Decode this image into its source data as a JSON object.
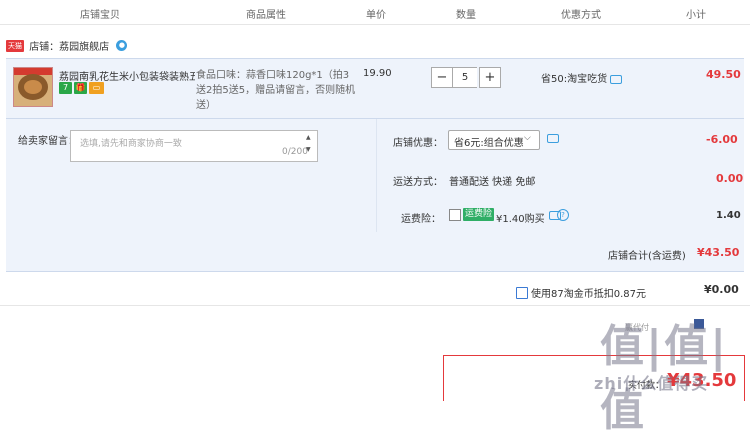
{
  "header": {
    "col_item": "店铺宝贝",
    "col_props": "商品属性",
    "col_price": "单价",
    "col_qty": "数量",
    "col_promo": "优惠方式",
    "col_subtotal": "小计"
  },
  "store": {
    "tag": "天猫",
    "name": "店铺：荔园旗舰店",
    "chat_icon": "chat-icon"
  },
  "item": {
    "title": "荔园南乳花生米小包装袋装熟五...",
    "badges": [
      {
        "text": "7",
        "color": "#2aa748"
      },
      {
        "text": "🎁",
        "color": "#2aa748"
      },
      {
        "text": "▭",
        "color": "#f0a020"
      }
    ],
    "props": "食品口味：蒜香口味120g*1（拍3送2拍5送5，赠品请留言，否则随机送）",
    "price": "19.90",
    "qty": "5",
    "promo": "省50:淘宝吃货",
    "subtotal": "49.50"
  },
  "message": {
    "label": "给卖家留言：",
    "placeholder": "选填,请先和商家协商一致",
    "counter": "0/200"
  },
  "store_discount": {
    "label": "店铺优惠：",
    "selected": "省6元:组合优惠",
    "amount": "-6.00"
  },
  "shipping": {
    "label": "运送方式：",
    "value": "普通配送 快递 免邮",
    "amount": "0.00"
  },
  "insurance": {
    "label": "运费险：",
    "tag": "运费险",
    "text": "¥1.40购买",
    "amount": "1.40"
  },
  "store_total": {
    "label": "店铺合计(含运费)",
    "amount": "¥43.50"
  },
  "coins": {
    "text": "使用87淘金币抵扣0.87元",
    "amount": "¥0.00"
  },
  "misc": {
    "gray_text": "赢代付",
    "watermark": "值|值|值",
    "watermark_url": "zhi什么值得买"
  },
  "payment": {
    "label": "实付款：",
    "amount": "¥43.50"
  },
  "colors": {
    "accent_red": "#e4393c",
    "panel_bg": "#eef3fb",
    "link_blue": "#3b9ede"
  }
}
